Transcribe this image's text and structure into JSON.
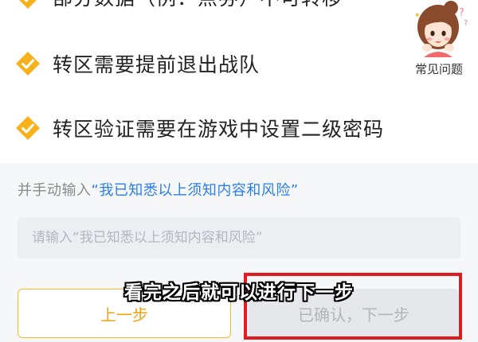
{
  "notices": [
    {
      "text": "部分数据（例：点券）不可转移",
      "icon": "check-diamond-icon"
    },
    {
      "text": "转区需要提前退出战队",
      "icon": "check-diamond-icon"
    },
    {
      "text": "转区验证需要在游戏中设置二级密码",
      "icon": "check-diamond-icon"
    }
  ],
  "faq": {
    "label": "常见问题",
    "avatar_icon": "cartoon-girl-avatar-icon"
  },
  "confirm": {
    "instruction_prefix": "并手动输入",
    "phrase": "“我已知悉以上须知内容和风险”",
    "input_value": "",
    "input_placeholder": "请输入“我已知悉以上须知内容和风险”"
  },
  "buttons": {
    "prev_label": "上一步",
    "next_label": "已确认，下一步"
  },
  "overlay": {
    "subtitle": "看完之后就可以进行下一步"
  },
  "colors": {
    "check_orange": "#f7b21b",
    "link_blue": "#2b7de9",
    "prev_border": "#f5b92e",
    "highlight_red": "#e01c1c"
  }
}
